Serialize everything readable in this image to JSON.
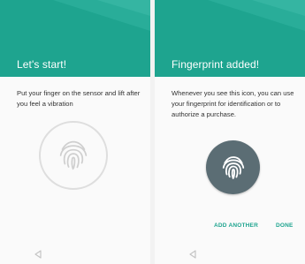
{
  "screens": [
    {
      "title": "Let's start!",
      "body": "Put your finger on the sensor and lift after you feel a vibration",
      "icon": "fingerprint-outline-icon"
    },
    {
      "title": "Fingerprint added!",
      "body": "Whenever you see this icon, you can use your fingerprint for identification or to authorize a purchase.",
      "icon": "fingerprint-filled-icon",
      "actions": {
        "add_another": "ADD ANOTHER",
        "done": "DONE"
      }
    }
  ],
  "nav": {
    "back_icon": "back-triangle-icon"
  },
  "colors": {
    "header": "#1ea48f",
    "accent": "#1ea48f",
    "fingerprint_badge": "#5b6d74",
    "background": "#fafafa"
  }
}
